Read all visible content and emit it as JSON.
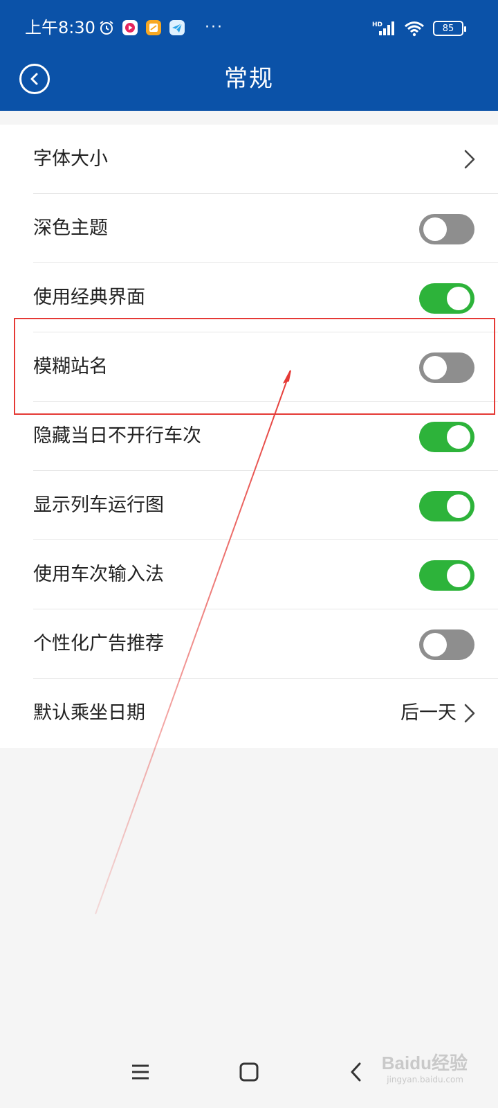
{
  "status_bar": {
    "time": "上午8:30",
    "more": "···",
    "battery": "85"
  },
  "header": {
    "title": "常规"
  },
  "settings": [
    {
      "label": "字体大小",
      "type": "link"
    },
    {
      "label": "深色主题",
      "type": "toggle",
      "on": false
    },
    {
      "label": "使用经典界面",
      "type": "toggle",
      "on": true
    },
    {
      "label": "模糊站名",
      "type": "toggle",
      "on": false
    },
    {
      "label": "隐藏当日不开行车次",
      "type": "toggle",
      "on": true
    },
    {
      "label": "显示列车运行图",
      "type": "toggle",
      "on": true
    },
    {
      "label": "使用车次输入法",
      "type": "toggle",
      "on": true
    },
    {
      "label": "个性化广告推荐",
      "type": "toggle",
      "on": false
    },
    {
      "label": "默认乘坐日期",
      "type": "link",
      "value": "后一天"
    }
  ],
  "watermark": {
    "text": "Baidu经验",
    "sub": "jingyan.baidu.com"
  },
  "colors": {
    "header_bg": "#0b52a8",
    "toggle_on": "#2db33a",
    "toggle_off": "#8e8e8e",
    "annotation": "#e53935"
  }
}
